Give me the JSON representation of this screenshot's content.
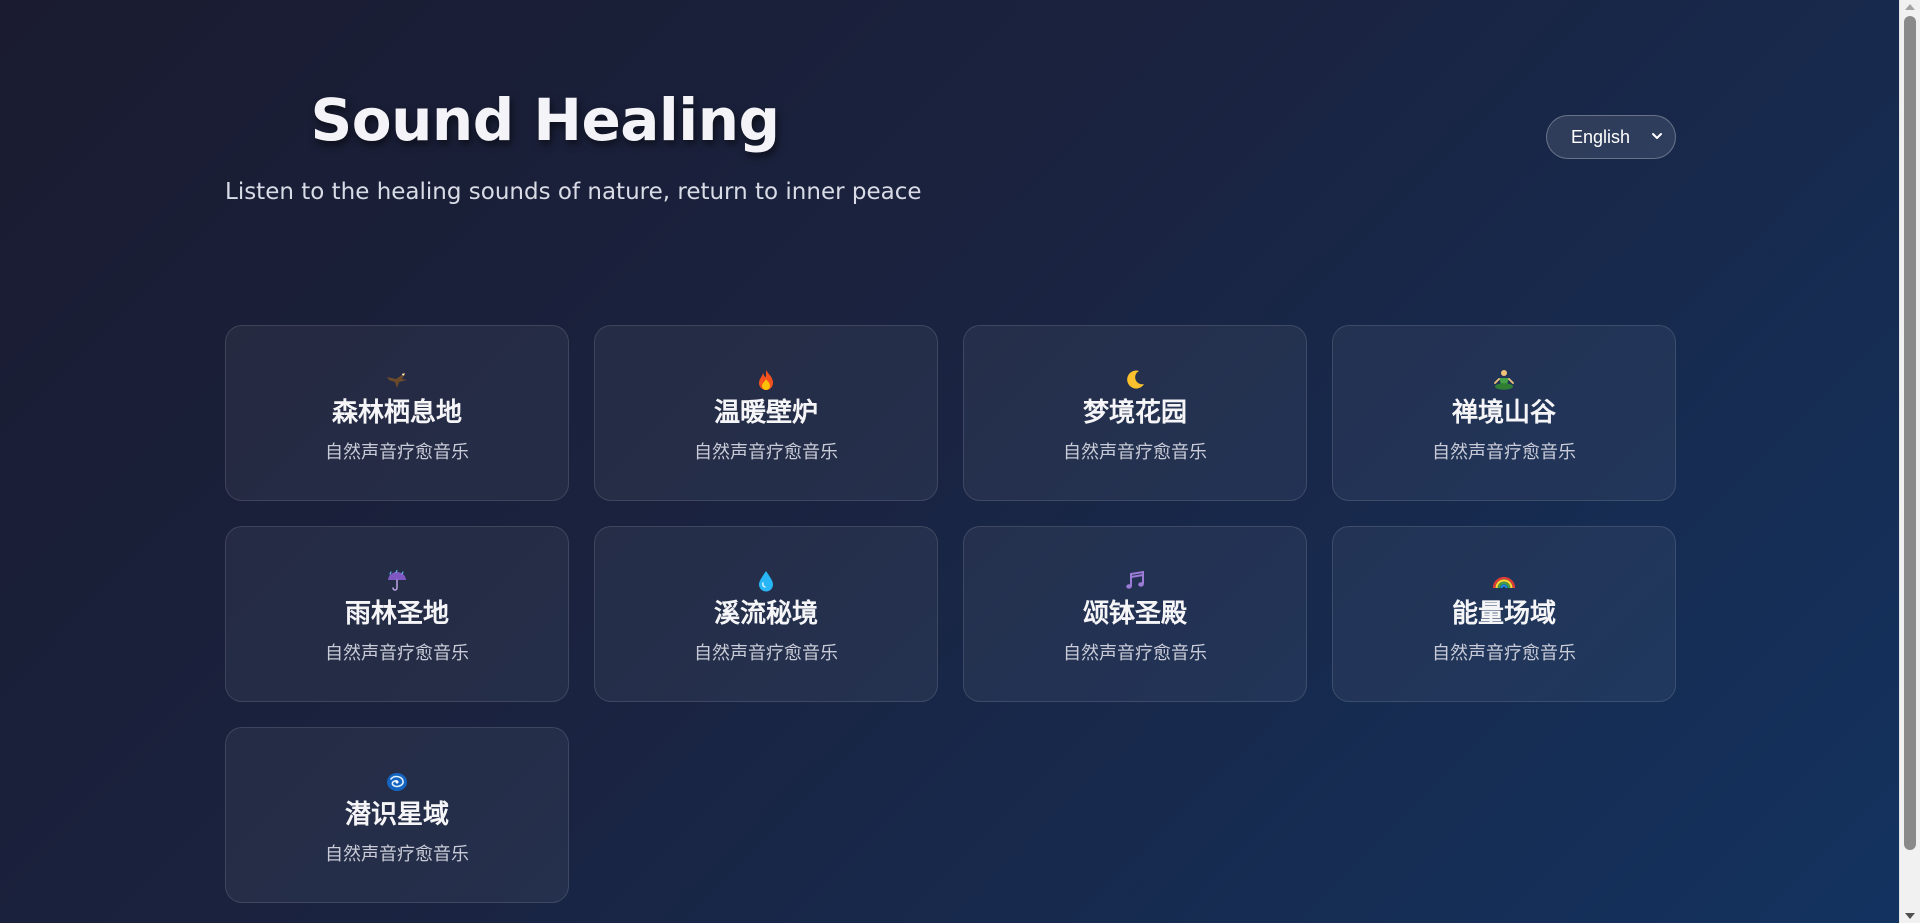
{
  "header": {
    "title": "Sound Healing",
    "subtitle": "Listen to the healing sounds of nature, return to inner peace"
  },
  "language_select": {
    "selected": "English",
    "icon": "chevron-down-icon"
  },
  "cards": [
    {
      "icon": "eagle-icon",
      "emoji": "🦅",
      "name": "森林栖息地",
      "description": "自然声音疗愈音乐"
    },
    {
      "icon": "fire-icon",
      "emoji": "🔥",
      "name": "温暖壁炉",
      "description": "自然声音疗愈音乐"
    },
    {
      "icon": "crescent-moon-icon",
      "emoji": "🌙",
      "name": "梦境花园",
      "description": "自然声音疗愈音乐"
    },
    {
      "icon": "meditation-icon",
      "emoji": "🧘",
      "name": "禅境山谷",
      "description": "自然声音疗愈音乐"
    },
    {
      "icon": "umbrella-rain-icon",
      "emoji": "☔",
      "name": "雨林圣地",
      "description": "自然声音疗愈音乐"
    },
    {
      "icon": "droplet-icon",
      "emoji": "💧",
      "name": "溪流秘境",
      "description": "自然声音疗愈音乐"
    },
    {
      "icon": "music-notes-icon",
      "emoji": "🎵",
      "name": "颂钵圣殿",
      "description": "自然声音疗愈音乐"
    },
    {
      "icon": "rainbow-icon",
      "emoji": "🌈",
      "name": "能量场域",
      "description": "自然声音疗愈音乐"
    },
    {
      "icon": "galaxy-icon",
      "emoji": "🌌",
      "name": "潜识星域",
      "description": "自然声音疗愈音乐"
    }
  ],
  "colors": {
    "background_start": "#1a1b30",
    "background_end": "#133360",
    "text_primary": "#f4f4f8",
    "text_secondary": "#c9ccd8"
  }
}
